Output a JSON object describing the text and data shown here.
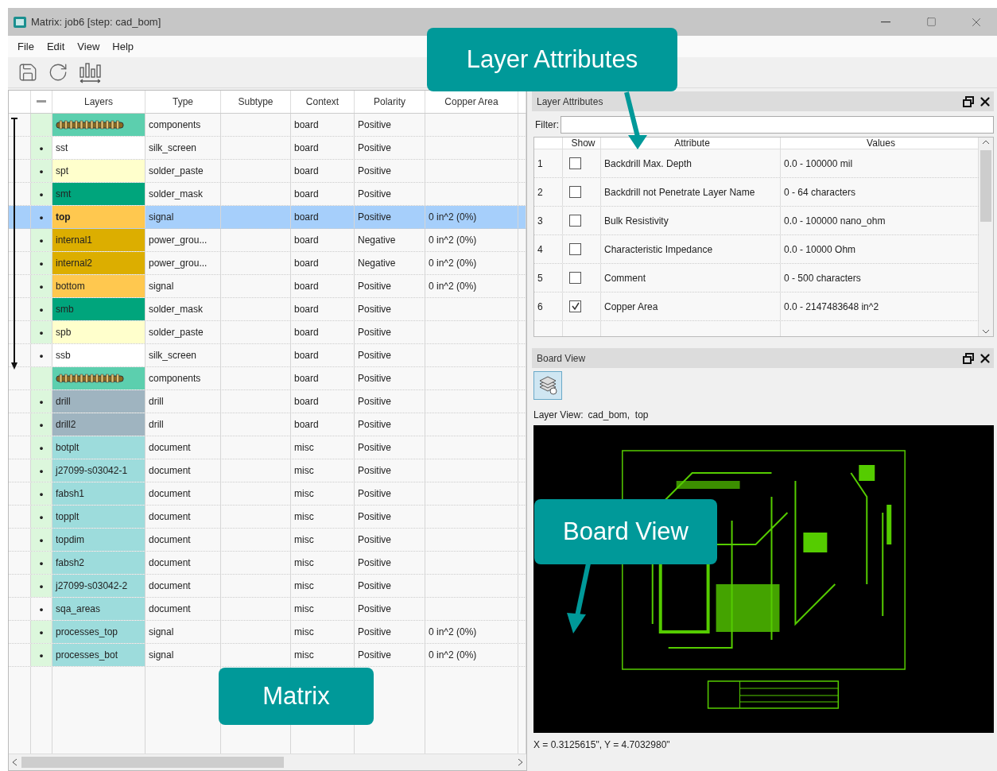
{
  "window": {
    "title": "Matrix: job6 [step: cad_bom]"
  },
  "menu": [
    "File",
    "Edit",
    "View",
    "Help"
  ],
  "matrix": {
    "columns": [
      "Layers",
      "Type",
      "Subtype",
      "Context",
      "Polarity",
      "Copper Area"
    ],
    "rows": [
      {
        "kind": "components",
        "color": "#5ccfae",
        "marked": true,
        "selected": false,
        "type": "components",
        "context": "board",
        "polarity": "Positive"
      },
      {
        "kind": "layer",
        "name": "sst",
        "bullet": "•",
        "color": "#ffffff",
        "marked": true,
        "selected": false,
        "type": "silk_screen",
        "context": "board",
        "polarity": "Positive"
      },
      {
        "kind": "layer",
        "name": "spt",
        "bullet": "•",
        "color": "#ffffcc",
        "marked": true,
        "selected": false,
        "type": "solder_paste",
        "context": "board",
        "polarity": "Positive"
      },
      {
        "kind": "layer",
        "name": "smt",
        "bullet": "•",
        "color": "#00a57c",
        "marked": true,
        "selected": false,
        "type": "solder_mask",
        "context": "board",
        "polarity": "Positive"
      },
      {
        "kind": "layer",
        "name": "top",
        "bullet": "•",
        "color": "#ffc84f",
        "marked": true,
        "selected": true,
        "type": "signal",
        "context": "board",
        "polarity": "Positive",
        "copper_area": "0 in^2 (0%)"
      },
      {
        "kind": "layer",
        "name": "internal1",
        "bullet": "•",
        "color": "#dcae00",
        "marked": true,
        "selected": false,
        "type": "power_grou...",
        "context": "board",
        "polarity": "Negative",
        "copper_area": "0 in^2 (0%)"
      },
      {
        "kind": "layer",
        "name": "internal2",
        "bullet": "•",
        "color": "#dcae00",
        "marked": true,
        "selected": false,
        "type": "power_grou...",
        "context": "board",
        "polarity": "Negative",
        "copper_area": "0 in^2 (0%)"
      },
      {
        "kind": "layer",
        "name": "bottom",
        "bullet": "•",
        "color": "#ffc84f",
        "marked": true,
        "selected": false,
        "type": "signal",
        "context": "board",
        "polarity": "Positive",
        "copper_area": "0 in^2 (0%)"
      },
      {
        "kind": "layer",
        "name": "smb",
        "bullet": "•",
        "color": "#00a57c",
        "marked": true,
        "selected": false,
        "type": "solder_mask",
        "context": "board",
        "polarity": "Positive"
      },
      {
        "kind": "layer",
        "name": "spb",
        "bullet": "•",
        "color": "#ffffcc",
        "marked": true,
        "selected": false,
        "type": "solder_paste",
        "context": "board",
        "polarity": "Positive"
      },
      {
        "kind": "layer",
        "name": "ssb",
        "bullet": "•",
        "color": "#ffffff",
        "marked": false,
        "selected": false,
        "type": "silk_screen",
        "context": "board",
        "polarity": "Positive"
      },
      {
        "kind": "components",
        "color": "#5ccfae",
        "marked": true,
        "selected": false,
        "type": "components",
        "context": "board",
        "polarity": "Positive"
      },
      {
        "kind": "layer",
        "name": "drill",
        "bullet": "•",
        "color": "#9fb4c0",
        "marked": true,
        "selected": false,
        "type": "drill",
        "context": "board",
        "polarity": "Positive"
      },
      {
        "kind": "layer",
        "name": "drill2",
        "bullet": "•",
        "color": "#9fb4c0",
        "marked": true,
        "selected": false,
        "type": "drill",
        "context": "board",
        "polarity": "Positive"
      },
      {
        "kind": "layer",
        "name": "botplt",
        "bullet": "•",
        "color": "#9ddcdc",
        "marked": true,
        "selected": false,
        "type": "document",
        "context": "misc",
        "polarity": "Positive"
      },
      {
        "kind": "layer",
        "name": "j27099-s03042-1",
        "bullet": "•",
        "color": "#9ddcdc",
        "marked": true,
        "selected": false,
        "type": "document",
        "context": "misc",
        "polarity": "Positive"
      },
      {
        "kind": "layer",
        "name": "fabsh1",
        "bullet": "•",
        "color": "#9ddcdc",
        "marked": true,
        "selected": false,
        "type": "document",
        "context": "misc",
        "polarity": "Positive"
      },
      {
        "kind": "layer",
        "name": "topplt",
        "bullet": "•",
        "color": "#9ddcdc",
        "marked": true,
        "selected": false,
        "type": "document",
        "context": "misc",
        "polarity": "Positive"
      },
      {
        "kind": "layer",
        "name": "topdim",
        "bullet": "•",
        "color": "#9ddcdc",
        "marked": true,
        "selected": false,
        "type": "document",
        "context": "misc",
        "polarity": "Positive"
      },
      {
        "kind": "layer",
        "name": "fabsh2",
        "bullet": "•",
        "color": "#9ddcdc",
        "marked": true,
        "selected": false,
        "type": "document",
        "context": "misc",
        "polarity": "Positive"
      },
      {
        "kind": "layer",
        "name": "j27099-s03042-2",
        "bullet": "•",
        "color": "#9ddcdc",
        "marked": true,
        "selected": false,
        "type": "document",
        "context": "misc",
        "polarity": "Positive"
      },
      {
        "kind": "layer",
        "name": "sqa_areas",
        "bullet": "•",
        "color": "#9ddcdc",
        "marked": false,
        "selected": false,
        "type": "document",
        "context": "misc",
        "polarity": "Positive"
      },
      {
        "kind": "layer",
        "name": "processes_top",
        "bullet": "•",
        "color": "#9ddcdc",
        "marked": true,
        "selected": false,
        "type": "signal",
        "context": "misc",
        "polarity": "Positive",
        "copper_area": "0 in^2 (0%)"
      },
      {
        "kind": "layer",
        "name": "processes_bot",
        "bullet": "•",
        "color": "#9ddcdc",
        "marked": true,
        "selected": false,
        "type": "signal",
        "context": "misc",
        "polarity": "Positive",
        "copper_area": "0 in^2 (0%)"
      }
    ]
  },
  "layer_attributes": {
    "title": "Layer Attributes",
    "filter_label": "Filter:",
    "columns": [
      "Show",
      "Attribute",
      "Values"
    ],
    "rows": [
      {
        "number": "1",
        "checked": false,
        "attribute": "Backdrill Max. Depth",
        "values": "0.0 - 100000 mil"
      },
      {
        "number": "2",
        "checked": false,
        "attribute": "Backdrill not Penetrate Layer Name",
        "values": "0 - 64 characters"
      },
      {
        "number": "3",
        "checked": false,
        "attribute": "Bulk Resistivity",
        "values": "0.0 - 100000 nano_ohm"
      },
      {
        "number": "4",
        "checked": false,
        "attribute": "Characteristic Impedance",
        "values": "0.0 - 10000 Ohm"
      },
      {
        "number": "5",
        "checked": false,
        "attribute": "Comment",
        "values": "0 - 500 characters"
      },
      {
        "number": "6",
        "checked": true,
        "attribute": "Copper Area",
        "values": "0.0 - 2147483648 in^2"
      }
    ]
  },
  "board_view": {
    "title": "Board View",
    "layer_view_label": "Layer View:",
    "layer_view_value": "cad_bom,  top",
    "coordinates": "X = 0.3125615\", Y = 4.7032980\""
  },
  "callouts": [
    {
      "text": "Layer Attributes"
    },
    {
      "text": "Matrix"
    },
    {
      "text": "Board View"
    }
  ]
}
